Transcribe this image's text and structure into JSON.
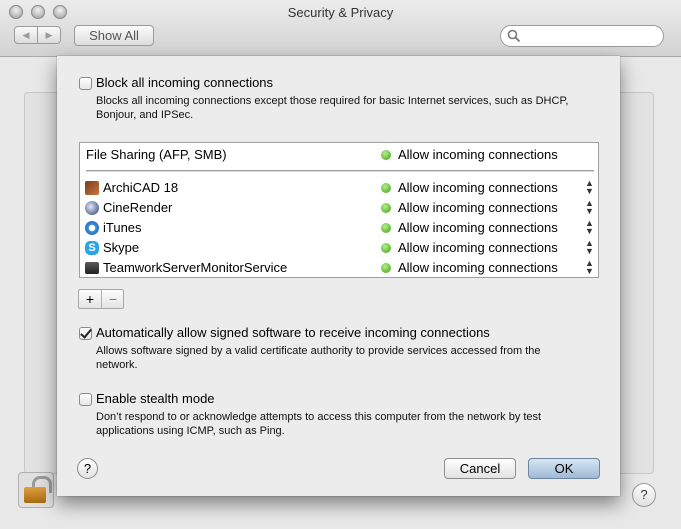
{
  "window": {
    "title": "Security & Privacy"
  },
  "toolbar": {
    "show_all_label": "Show All",
    "back_icon": "left-arrow-icon",
    "forward_icon": "right-arrow-icon",
    "search_placeholder": ""
  },
  "firewall_options": {
    "block_all": {
      "label": "Block all incoming connections",
      "checked": false,
      "description": "Blocks all incoming connections except those required for basic Internet services, such as DHCP, Bonjour, and IPSec."
    },
    "services": [
      {
        "name": "File Sharing (AFP, SMB)",
        "status": "Allow incoming connections",
        "icon": "",
        "status_color": "#3a9e14"
      }
    ],
    "apps": [
      {
        "name": "ArchiCAD 18",
        "status": "Allow incoming connections",
        "icon": "archicad-icon",
        "status_color": "#3a9e14"
      },
      {
        "name": "CineRender",
        "status": "Allow incoming connections",
        "icon": "cinerender-icon",
        "status_color": "#3a9e14"
      },
      {
        "name": "iTunes",
        "status": "Allow incoming connections",
        "icon": "itunes-icon",
        "status_color": "#3a9e14"
      },
      {
        "name": "Skype",
        "status": "Allow incoming connections",
        "icon": "skype-icon",
        "status_color": "#3a9e14"
      },
      {
        "name": "TeamworkServerMonitorService",
        "status": "Allow incoming connections",
        "icon": "application-icon",
        "status_color": "#3a9e14"
      }
    ],
    "add_label": "+",
    "remove_label": "−",
    "signed_software": {
      "label": "Automatically allow signed software to receive incoming connections",
      "checked": true,
      "description": "Allows software signed by a valid certificate authority to provide services accessed from the network."
    },
    "stealth_mode": {
      "label": "Enable stealth mode",
      "checked": false,
      "description": "Don’t respond to or acknowledge attempts to access this computer from the network by test applications using ICMP, such as Ping."
    },
    "help_label": "?",
    "cancel_label": "Cancel",
    "ok_label": "OK"
  },
  "background": {
    "help_label": "?",
    "lock_icon": "lock-icon"
  }
}
